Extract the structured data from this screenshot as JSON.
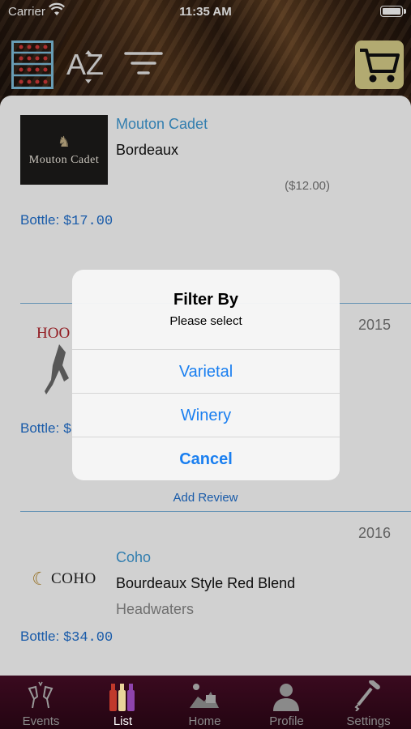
{
  "status_bar": {
    "carrier": "Carrier",
    "time": "11:35 AM"
  },
  "toolbar": {
    "rack_icon": "wine-rack-icon",
    "sort_icon": "sort-az-icon",
    "filter_icon": "filter-icon",
    "cart_icon": "shopping-cart-icon",
    "cart_bg": "#d9d08a"
  },
  "wines": [
    {
      "winery": "Mouton Cadet",
      "name": "Bordeaux",
      "price_note": "($12.00)",
      "bottle_label": "Bottle:",
      "bottle_price": "$17.00",
      "logo": "Mouton Cadet"
    },
    {
      "vintage": "2015",
      "bottle_label": "Bottle:",
      "bottle_price": "$",
      "logo": "HOO",
      "add_review": "Add Review"
    },
    {
      "vintage": "2016",
      "winery": "Coho",
      "name": "Bourdeaux Style Red Blend",
      "region": "Headwaters",
      "bottle_label": "Bottle:",
      "bottle_price": "$34.00",
      "logo": "COHO"
    }
  ],
  "alert": {
    "title": "Filter By",
    "message": "Please select",
    "options": [
      "Varietal",
      "Winery"
    ],
    "cancel": "Cancel"
  },
  "tabs": [
    {
      "label": "Events",
      "icon": "toast-glasses-icon"
    },
    {
      "label": "List",
      "icon": "wine-bottles-icon",
      "active": true
    },
    {
      "label": "Home",
      "icon": "vineyard-icon"
    },
    {
      "label": "Profile",
      "icon": "person-icon"
    },
    {
      "label": "Settings",
      "icon": "corkscrew-icon"
    }
  ],
  "colors": {
    "accent_link": "#3d9ad6",
    "price_blue": "#1f6fcf",
    "alert_button": "#1a7ff0",
    "tabbar": "#3a0a1f"
  }
}
